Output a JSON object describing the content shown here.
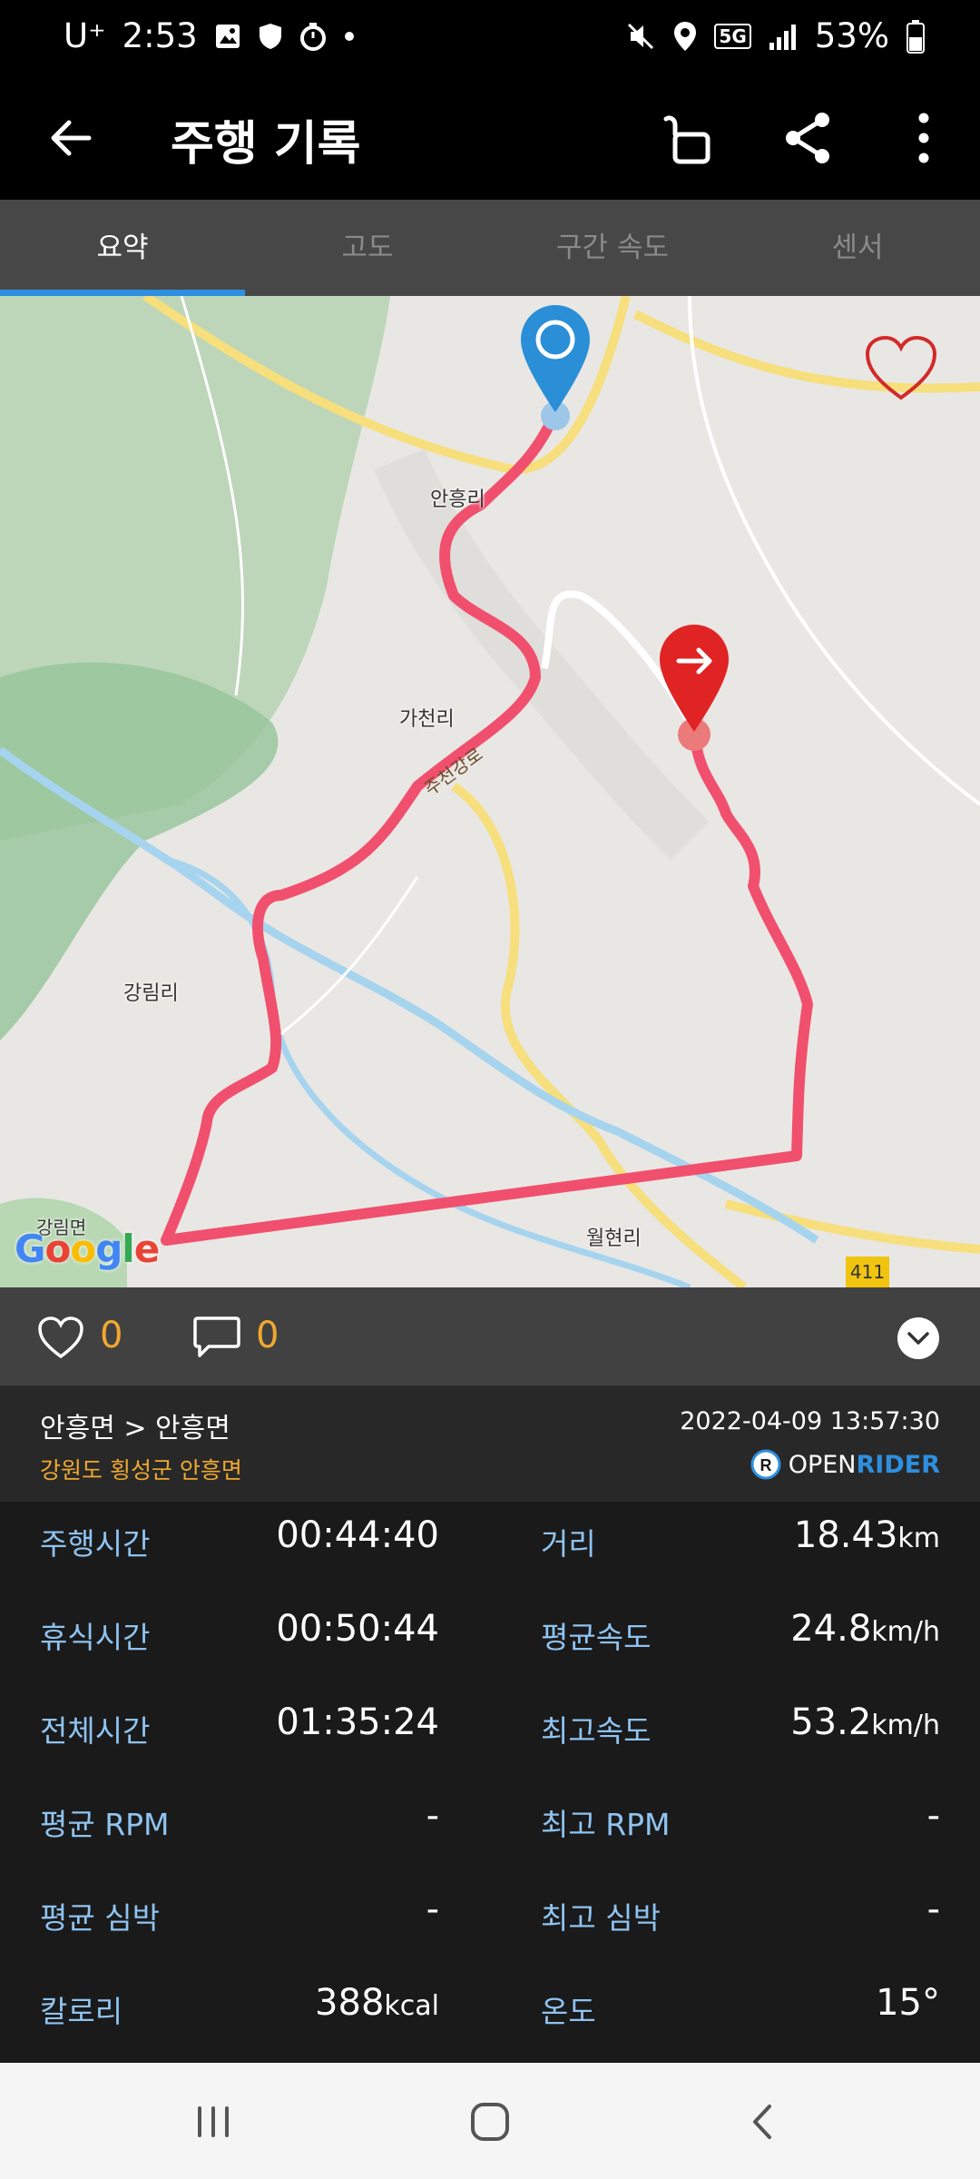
{
  "status": {
    "carrier": "U⁺",
    "time": "2:53",
    "battery": "53%",
    "network": "5G",
    "icons_left": [
      "gallery-icon",
      "shield-icon",
      "timer-icon",
      "dot-icon"
    ],
    "icons_right": [
      "mute-icon",
      "location-icon",
      "5g-icon",
      "signal-icon",
      "battery-icon"
    ]
  },
  "appbar": {
    "title": "주행 기록"
  },
  "tabs": [
    {
      "label": "요약",
      "active": true
    },
    {
      "label": "고도",
      "active": false
    },
    {
      "label": "구간 속도",
      "active": false
    },
    {
      "label": "센서",
      "active": false
    }
  ],
  "map": {
    "places": [
      "안흥리",
      "가천리",
      "강림리",
      "월현리",
      "강림면"
    ],
    "road_name": "주천강로",
    "route_number": "411",
    "provider": "Google",
    "route_color": "#f0506e",
    "start_marker_color": "#2a8fd6",
    "end_marker_color": "#e02424"
  },
  "social": {
    "likes": "0",
    "comments": "0"
  },
  "ride": {
    "route": "안흥면 > 안흥면",
    "region": "강원도 횡성군 안흥면",
    "datetime": "2022-04-09 13:57:30",
    "brand_prefix": "OPEN",
    "brand_suffix": "RIDER"
  },
  "stats": {
    "ride_time": {
      "label": "주행시간",
      "value": "00:44:40"
    },
    "distance": {
      "label": "거리",
      "value": "18.43",
      "unit": "km"
    },
    "rest_time": {
      "label": "휴식시간",
      "value": "00:50:44"
    },
    "avg_speed": {
      "label": "평균속도",
      "value": "24.8",
      "unit": "km/h"
    },
    "total_time": {
      "label": "전체시간",
      "value": "01:35:24"
    },
    "max_speed": {
      "label": "최고속도",
      "value": "53.2",
      "unit": "km/h"
    },
    "avg_rpm": {
      "label": "평균 RPM",
      "value": "-"
    },
    "max_rpm": {
      "label": "최고 RPM",
      "value": "-"
    },
    "avg_hr": {
      "label": "평균 심박",
      "value": "-"
    },
    "max_hr": {
      "label": "최고 심박",
      "value": "-"
    },
    "calories": {
      "label": "칼로리",
      "value": "388",
      "unit": "kcal"
    },
    "temperature": {
      "label": "온도",
      "value": "15°"
    }
  }
}
